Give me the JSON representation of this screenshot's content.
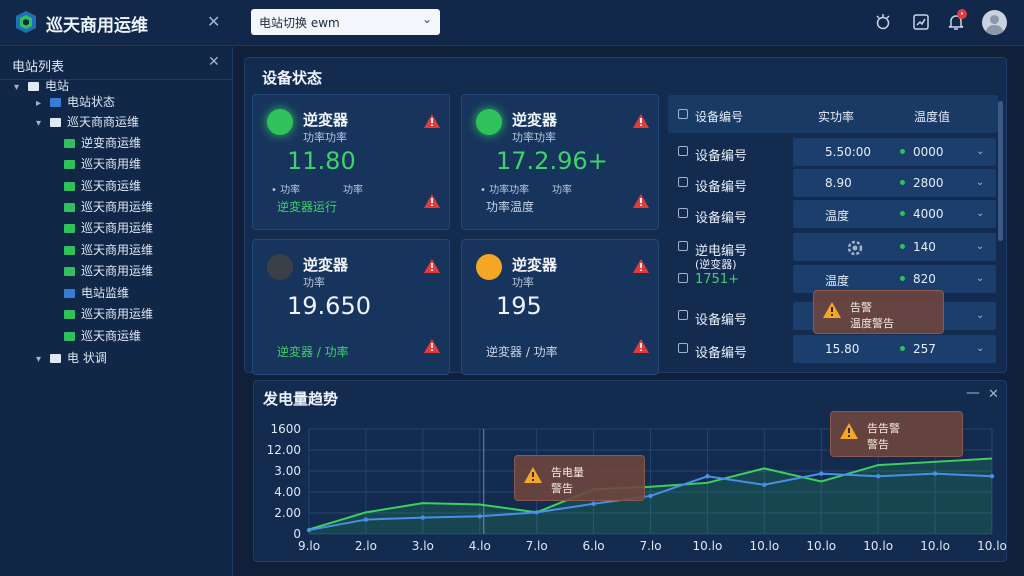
{
  "header": {
    "app_title": "巡天商用运维",
    "station_select": "电站切换  ewm"
  },
  "sidebar": {
    "title": "电站列表",
    "items": [
      {
        "label": "电站",
        "level": 0,
        "icon": "white"
      },
      {
        "label": "电站状态",
        "level": 1,
        "icon": "blue"
      },
      {
        "label": "巡天商商运维",
        "level": 1,
        "icon": "white"
      },
      {
        "label": "逆变商运维",
        "level": 2,
        "icon": "green"
      },
      {
        "label": "巡天商用维",
        "level": 2,
        "icon": "green"
      },
      {
        "label": "巡天商运维",
        "level": 2,
        "icon": "green"
      },
      {
        "label": "巡天商用运维",
        "level": 2,
        "icon": "green"
      },
      {
        "label": "巡天商用运维",
        "level": 2,
        "icon": "green"
      },
      {
        "label": "巡天商用运维",
        "level": 2,
        "icon": "green"
      },
      {
        "label": "巡天商用运维",
        "level": 2,
        "icon": "green"
      },
      {
        "label": "电站监维",
        "level": 2,
        "icon": "blue"
      },
      {
        "label": "巡天商用运维",
        "level": 2,
        "icon": "green"
      },
      {
        "label": "巡天商运维",
        "level": 2,
        "icon": "green"
      },
      {
        "label": "电 状调",
        "level": 0,
        "icon": "white"
      }
    ]
  },
  "device_status": {
    "title": "设备状态",
    "cards": [
      {
        "name": "逆変器",
        "sub": "功率功率",
        "value": "11.80",
        "value_color": "#3fd16b",
        "lbl_left": "• 功率",
        "lbl_right": "功率",
        "foot": "逆変器运行",
        "foot_color": "#3fd16b",
        "dot": "#2fc25b"
      },
      {
        "name": "逆変器",
        "sub": "功率功率",
        "value": "17.2.96+",
        "value_color": "#3fd16b",
        "lbl_left": "• 功率功率",
        "lbl_right": "功率",
        "foot": "功率温度",
        "foot_color": "#c9d6e8",
        "dot": "#2fc25b"
      },
      {
        "name": "逆変器",
        "sub": "功率",
        "value": "19.650",
        "value_color": "#eef4ff",
        "lbl_left": "",
        "lbl_right": "",
        "foot": "逆変器 / 功率",
        "foot_color": "#3fd16b",
        "dot": "#3a3f48"
      },
      {
        "name": "逆変器",
        "sub": "功率",
        "value": "195",
        "value_color": "#eef4ff",
        "lbl_left": "",
        "lbl_right": "",
        "foot": "逆変器 / 功率",
        "foot_color": "#c9d6e8",
        "dot": "#f5a623"
      }
    ]
  },
  "device_table": {
    "headers": [
      "设备编号",
      "实功率",
      "温度值"
    ],
    "rows": [
      {
        "id": "设备编号",
        "power": "5.50:00",
        "temp": "0000"
      },
      {
        "id": "设备编号",
        "power": "8.90",
        "temp": "2800"
      },
      {
        "id": "设备编号",
        "power": "温度",
        "temp": "4000"
      },
      {
        "id": "逆电编号",
        "id2": "(逆变器)",
        "power": "",
        "temp": "140"
      },
      {
        "id": "1751+",
        "power": "温度",
        "temp": "820"
      },
      {
        "id": "设备编号",
        "power": "",
        "temp": ""
      },
      {
        "id": "设备编号",
        "power": "15.80",
        "temp": "257"
      }
    ],
    "tooltip": {
      "line1": "告警",
      "line2": "温度警告"
    }
  },
  "power_chart": {
    "title": "发电量趋势",
    "tooltip_a": {
      "line1": "告电量",
      "line2": "警告"
    },
    "tooltip_b": {
      "line1": "告告警",
      "line2": "警告"
    }
  },
  "chart_data": {
    "type": "area",
    "title": "发电量趋势",
    "categories": [
      "9.lo",
      "2.lo",
      "3.lo",
      "4.lo",
      "7.lo",
      "6.lo",
      "7.lo",
      "10.lo",
      "10.lo",
      "10.lo",
      "10.lo",
      "10.lo",
      "10.lo"
    ],
    "y_ticks": [
      "1600",
      "12.00",
      "3.00",
      "4.00",
      "2.00",
      "0"
    ],
    "ylim": [
      0,
      1600
    ],
    "series": [
      {
        "color": "#3ecf5f",
        "values": [
          70,
          330,
          470,
          450,
          330,
          680,
          720,
          780,
          1000,
          800,
          1050,
          1100,
          1150
        ]
      },
      {
        "color": "#4a8fe7",
        "values": [
          60,
          220,
          250,
          270,
          330,
          460,
          580,
          880,
          750,
          920,
          880,
          920,
          880
        ]
      }
    ],
    "grid": true
  }
}
